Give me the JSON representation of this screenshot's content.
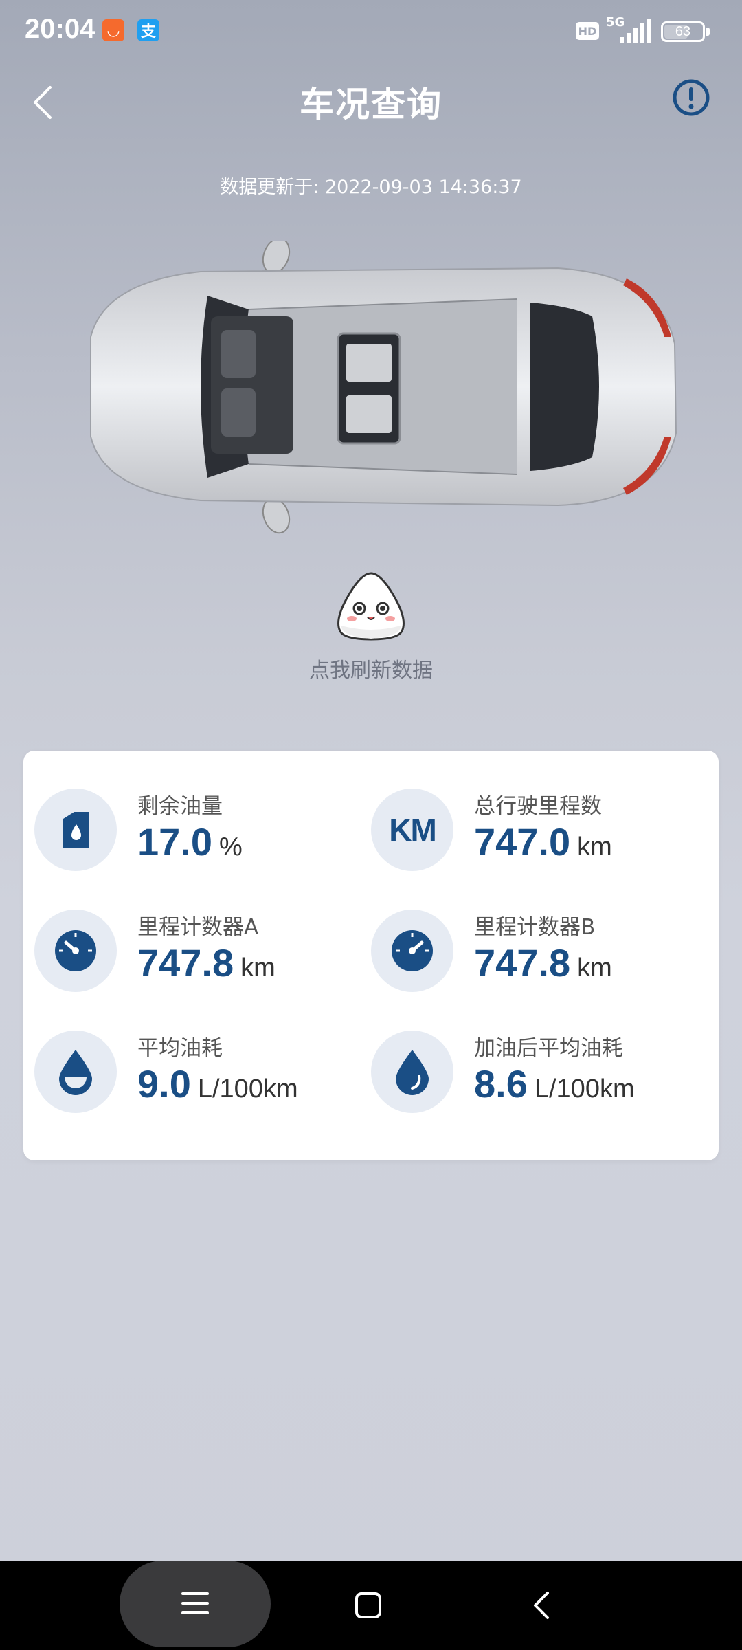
{
  "status_bar": {
    "time": "20:04",
    "app_badges": [
      "taobao-icon",
      "alipay-icon"
    ],
    "hd": "HD",
    "network": "5G",
    "battery": "63",
    "battery_level": 0.63
  },
  "header": {
    "title": "车况查询",
    "back_icon": "chevron-left-icon",
    "info_icon": "info-circle-icon"
  },
  "update_time": "数据更新于: 2022-09-03 14:36:37",
  "refresh": {
    "label": "点我刷新数据",
    "mascot_icon": "rice-ball-mascot-icon"
  },
  "stats": [
    {
      "label": "剩余油量",
      "value": "17.0",
      "unit": "%",
      "icon": "fuel-can-icon"
    },
    {
      "label": "总行驶里程数",
      "value": "747.0",
      "unit": "km",
      "icon": "km-icon",
      "icon_text": "KM"
    },
    {
      "label": "里程计数器A",
      "value": "747.8",
      "unit": "km",
      "icon": "gauge-icon"
    },
    {
      "label": "里程计数器B",
      "value": "747.8",
      "unit": "km",
      "icon": "gauge-icon"
    },
    {
      "label": "平均油耗",
      "value": "9.0",
      "unit": "L/100km",
      "icon": "droplet-icon"
    },
    {
      "label": "加油后平均油耗",
      "value": "8.6",
      "unit": "L/100km",
      "icon": "droplet-icon"
    }
  ],
  "colors": {
    "accent": "#1a4e85",
    "icon_bg": "#e6ebf3",
    "nav_bg": "#000000"
  },
  "nav": {
    "menu_icon": "menu-icon",
    "home_icon": "home-square-icon",
    "back_icon": "back-chevron-icon"
  }
}
